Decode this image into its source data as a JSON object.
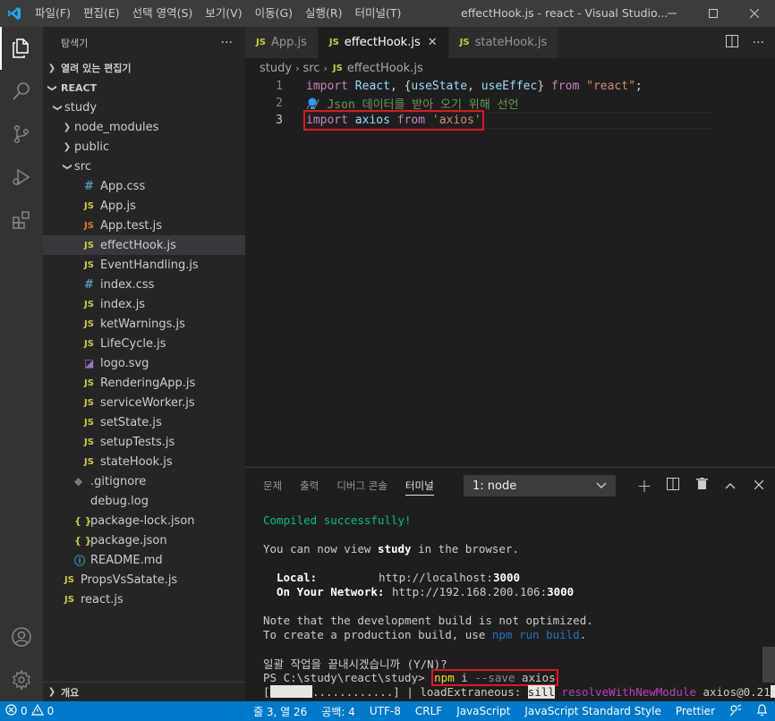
{
  "titlebar": {
    "menu": [
      "파일(F)",
      "편집(E)",
      "선택 영역(S)",
      "보기(V)",
      "이동(G)",
      "실행(R)",
      "터미널(T)"
    ],
    "title": "effectHook.js - react - Visual Studio..."
  },
  "sidebar": {
    "title": "탐색기",
    "more": "···",
    "open_editors": "열려 있는 편집기",
    "root": "REACT",
    "outline": "개요",
    "tree": [
      {
        "label": "study",
        "type": "folder-open",
        "depth": 0
      },
      {
        "label": "node_modules",
        "type": "folder",
        "depth": 1
      },
      {
        "label": "public",
        "type": "folder",
        "depth": 1
      },
      {
        "label": "src",
        "type": "folder-open",
        "depth": 1
      },
      {
        "label": "App.css",
        "type": "css",
        "depth": 2
      },
      {
        "label": "App.js",
        "type": "js",
        "depth": 2
      },
      {
        "label": "App.test.js",
        "type": "jst",
        "depth": 2
      },
      {
        "label": "effectHook.js",
        "type": "js",
        "depth": 2,
        "selected": true
      },
      {
        "label": "EventHandling.js",
        "type": "js",
        "depth": 2
      },
      {
        "label": "index.css",
        "type": "css",
        "depth": 2
      },
      {
        "label": "index.js",
        "type": "js",
        "depth": 2
      },
      {
        "label": "ketWarnings.js",
        "type": "js",
        "depth": 2
      },
      {
        "label": "LifeCycle.js",
        "type": "js",
        "depth": 2
      },
      {
        "label": "logo.svg",
        "type": "svg",
        "depth": 2
      },
      {
        "label": "RenderingApp.js",
        "type": "js",
        "depth": 2
      },
      {
        "label": "serviceWorker.js",
        "type": "js",
        "depth": 2
      },
      {
        "label": "setState.js",
        "type": "js",
        "depth": 2
      },
      {
        "label": "setupTests.js",
        "type": "js",
        "depth": 2
      },
      {
        "label": "stateHook.js",
        "type": "js",
        "depth": 2
      },
      {
        "label": ".gitignore",
        "type": "dot",
        "depth": 1
      },
      {
        "label": "debug.log",
        "type": "log",
        "depth": 1
      },
      {
        "label": "package-lock.json",
        "type": "json",
        "depth": 1
      },
      {
        "label": "package.json",
        "type": "json",
        "depth": 1
      },
      {
        "label": "README.md",
        "type": "info",
        "depth": 1
      },
      {
        "label": "PropsVsSatate.js",
        "type": "js",
        "depth": 0
      },
      {
        "label": "react.js",
        "type": "js",
        "depth": 0
      }
    ]
  },
  "editor": {
    "tabs": [
      {
        "label": "App.js",
        "active": false
      },
      {
        "label": "effectHook.js",
        "active": true
      },
      {
        "label": "stateHook.js",
        "active": false
      }
    ],
    "breadcrumb": [
      "study",
      "src",
      "effectHook.js"
    ],
    "lines": [
      {
        "num": "1",
        "parts": [
          [
            "kw",
            "import"
          ],
          [
            "pl",
            " "
          ],
          [
            "var",
            "React"
          ],
          [
            "pl",
            ", {"
          ],
          [
            "var",
            "useState"
          ],
          [
            "pl",
            ", "
          ],
          [
            "var",
            "useEffec"
          ],
          [
            "pl",
            "} "
          ],
          [
            "kw",
            "from"
          ],
          [
            "pl",
            " "
          ],
          [
            "str",
            "\"react\""
          ],
          [
            "pl",
            ";"
          ]
        ]
      },
      {
        "num": "2",
        "parts": [
          [
            "cmt",
            "// Json 데이터를 받아 오기 위해 선언"
          ]
        ]
      },
      {
        "num": "3",
        "parts": [
          [
            "kw",
            "import"
          ],
          [
            "pl",
            " "
          ],
          [
            "var",
            "axios"
          ],
          [
            "pl",
            " "
          ],
          [
            "kw",
            "from"
          ],
          [
            "pl",
            " "
          ],
          [
            "str",
            "'axios'"
          ]
        ]
      }
    ]
  },
  "panel": {
    "tabs": [
      "문제",
      "출력",
      "디버그 콘솔",
      "터미널"
    ],
    "active_tab": "터미널",
    "terminal_select": "1: node",
    "terminal": {
      "compiled": "Compiled successfully!",
      "view_pre": "You can now view ",
      "view_app": "study",
      "view_post": " in the browser.",
      "local_label": "Local:",
      "local_url": "http://localhost:",
      "local_port": "3000",
      "network_label": "On Your Network:",
      "network_url": "http://192.168.200.106:",
      "network_port": "3000",
      "note1": "Note that the development build is not optimized.",
      "note2_pre": "To create a production build, use ",
      "note2_cmd": "npm run build",
      "note2_post": ".",
      "batch": "일괄 작업을 끝내시겠습니까 (Y/N)?",
      "prompt": "PS C:\\study\\react\\study> ",
      "cmd_npm": "npm",
      "cmd_i": " i ",
      "cmd_flag": "--save",
      "cmd_pkg": " axios",
      "prog_open": "[",
      "prog_dots": "............",
      "prog_close": "] | loadExtraneous: ",
      "prog_sill": "sill",
      "prog_fn": " resolveWithNewModule",
      "prog_pkg": " axios@0.21"
    }
  },
  "status": {
    "errors": "0",
    "warnings": "0",
    "position": "줄 3, 열 26",
    "spaces": "공백: 4",
    "encoding": "UTF-8",
    "eol": "CRLF",
    "language": "JavaScript",
    "linter": "JavaScript Standard Style",
    "formatter": "Prettier"
  }
}
